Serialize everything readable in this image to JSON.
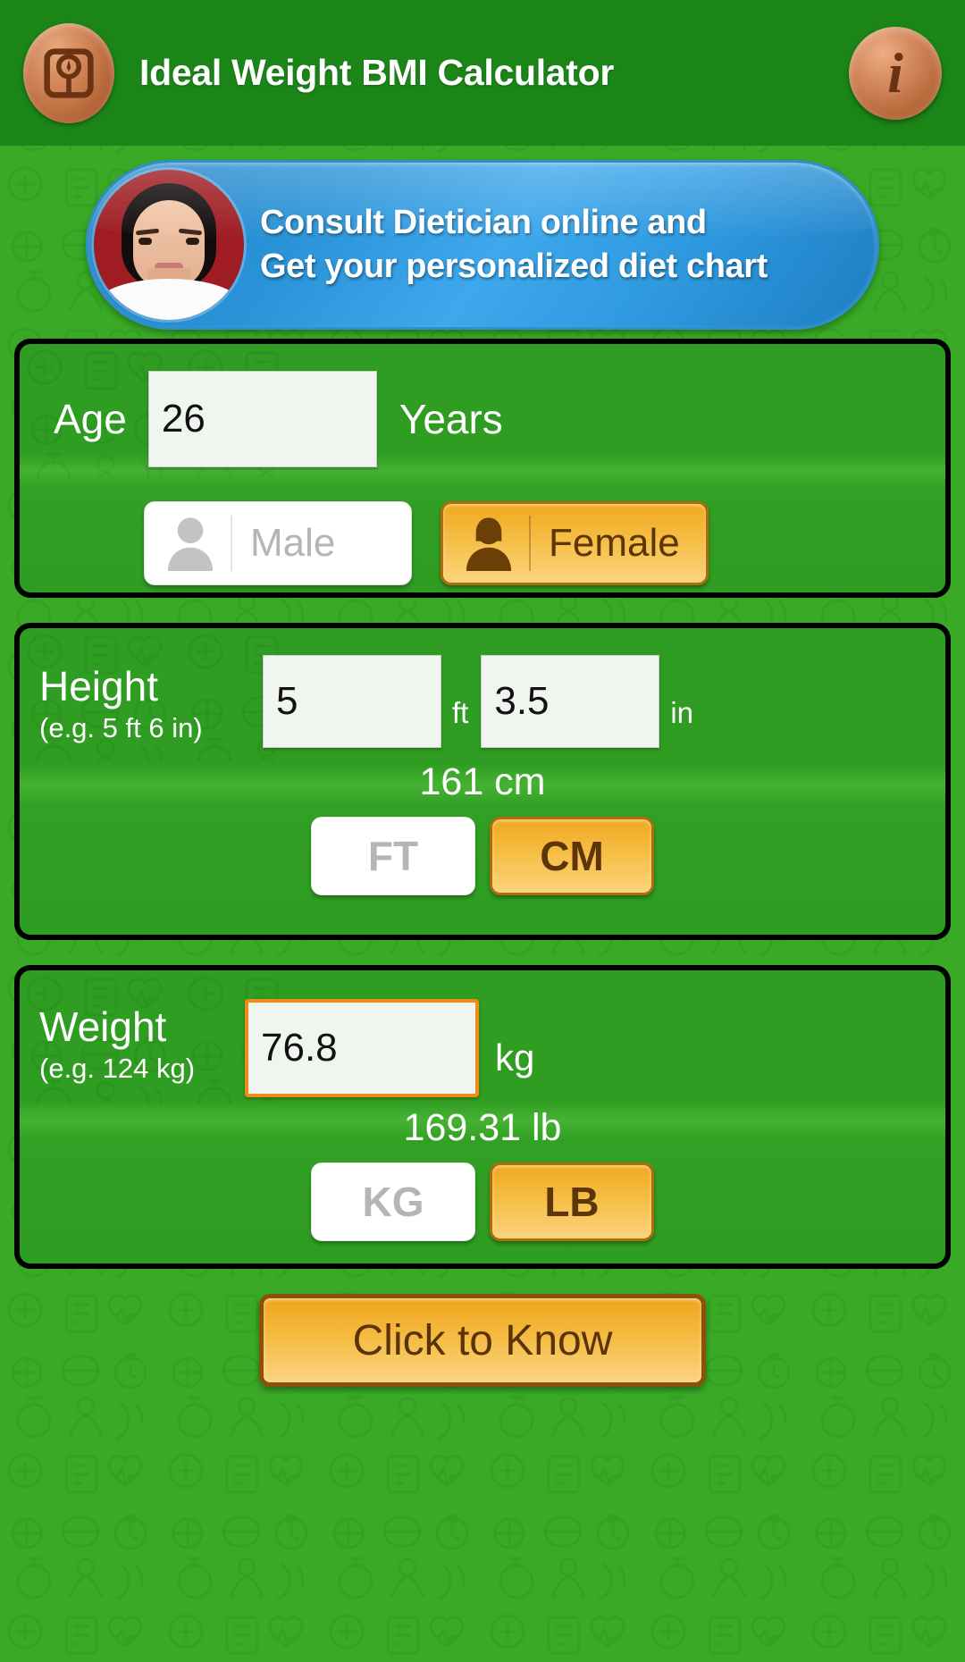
{
  "header": {
    "title": "Ideal Weight BMI Calculator",
    "app_icon": "weighing-scale-icon",
    "info_icon": "info-icon",
    "info_glyph": "i",
    "bg_color": "#1b8518"
  },
  "banner": {
    "line1": "Consult Dietician online and",
    "line2": "Get your personalized diet chart",
    "avatar_icon": "dietician-portrait",
    "bg_color": "#2a93d8"
  },
  "age_card": {
    "label": "Age",
    "value": "26",
    "unit": "Years",
    "gender": {
      "male": {
        "label": "Male",
        "icon": "person-icon",
        "selected": false
      },
      "female": {
        "label": "Female",
        "icon": "person-icon",
        "selected": true
      }
    }
  },
  "height_card": {
    "label": "Height",
    "hint": "(e.g. 5 ft 6 in)",
    "ft_value": "5",
    "ft_unit": "ft",
    "in_value": "3.5",
    "in_unit": "in",
    "converted": "161 cm",
    "units": {
      "ft": {
        "label": "FT",
        "selected": false
      },
      "cm": {
        "label": "CM",
        "selected": true
      }
    }
  },
  "weight_card": {
    "label": "Weight",
    "hint": "(e.g. 124 kg)",
    "value": "76.8",
    "unit": "kg",
    "converted": "169.31 lb",
    "units": {
      "kg": {
        "label": "KG",
        "selected": false
      },
      "lb": {
        "label": "LB",
        "selected": true
      }
    }
  },
  "submit": {
    "label": "Click to Know"
  },
  "colors": {
    "page_green": "#3aaa26",
    "header_green": "#1b8518",
    "card_green": "#2f9c22",
    "accent_orange": "#f0a81f",
    "accent_orange_border": "#b06c0a",
    "input_bg": "#f1f5ef"
  }
}
